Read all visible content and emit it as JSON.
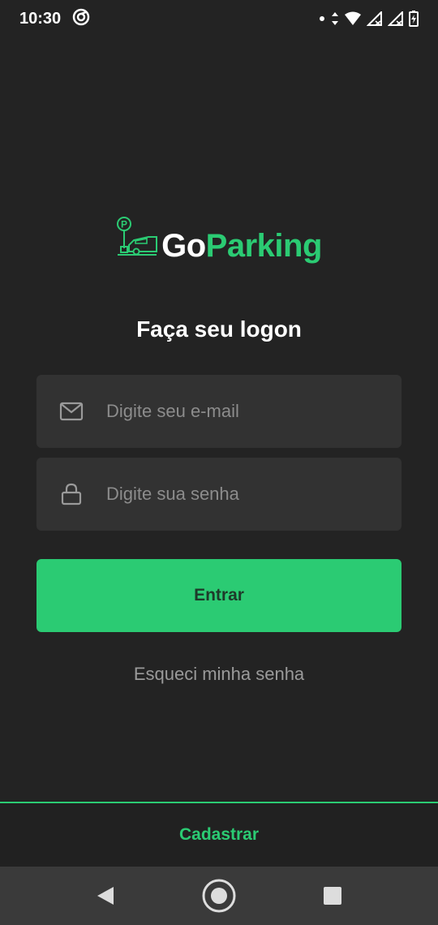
{
  "status_bar": {
    "time": "10:30"
  },
  "logo": {
    "part1": "Go",
    "part2": "Parking"
  },
  "title": "Faça seu logon",
  "form": {
    "email_placeholder": "Digite seu e-mail",
    "password_placeholder": "Digite sua senha",
    "submit_label": "Entrar"
  },
  "forgot_label": "Esqueci minha senha",
  "footer": {
    "signup_label": "Cadastrar"
  },
  "icons": {
    "email": "mail-icon",
    "password": "lock-icon",
    "logo": "parking-car-icon",
    "nav_back": "back-triangle-icon",
    "nav_home": "home-circle-icon",
    "nav_recents": "recents-square-icon"
  },
  "colors": {
    "background": "#232323",
    "accent": "#2bcb73",
    "input_bg": "#323232",
    "placeholder": "#8c8c8c"
  }
}
